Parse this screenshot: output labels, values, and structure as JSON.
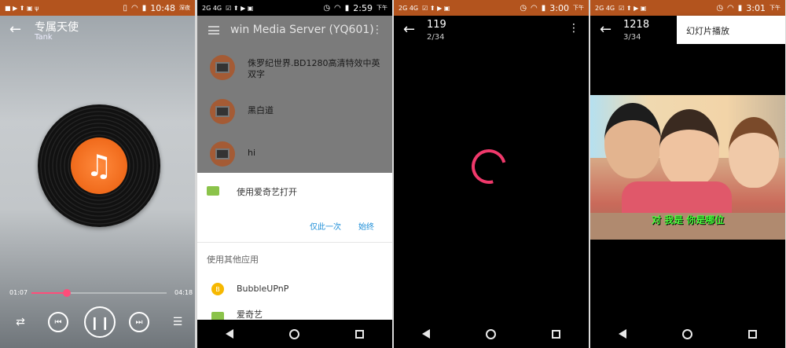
{
  "phone1": {
    "status": {
      "time": "10:48",
      "suffix": "深夜"
    },
    "title": "专属天使",
    "artist": "Tank",
    "elapsed": "01:07",
    "duration": "04:18",
    "progress": 0.26,
    "colors": {
      "accent": "#ff4d7a",
      "statusbar": "#b3541e"
    }
  },
  "phone2": {
    "status": {
      "left": "2G 4G",
      "time": "2:59",
      "suffix": "下午"
    },
    "title": "win  Media Server (YQ601)",
    "files": [
      {
        "label": "侏罗纪世界.BD1280高清特效中英双字"
      },
      {
        "label": "黑白道"
      },
      {
        "label": "hi"
      }
    ],
    "sheet": {
      "open_with": "使用爱奇艺打开",
      "just_once": "仅此一次",
      "always": "始终",
      "other_apps": "使用其他应用",
      "apps": [
        "BubbleUPnP",
        "爱奇艺"
      ],
      "bubble_badge": "B"
    }
  },
  "phone3": {
    "status": {
      "left": "2G 4G",
      "time": "3:00",
      "suffix": "下午"
    },
    "title": "119",
    "counter": "2/34"
  },
  "phone4": {
    "status": {
      "left": "2G 4G",
      "time": "3:01",
      "suffix": "下午"
    },
    "title": "1218",
    "counter": "3/34",
    "menu_item": "幻灯片播放",
    "subtitle": "对 我是 你是哪位"
  }
}
